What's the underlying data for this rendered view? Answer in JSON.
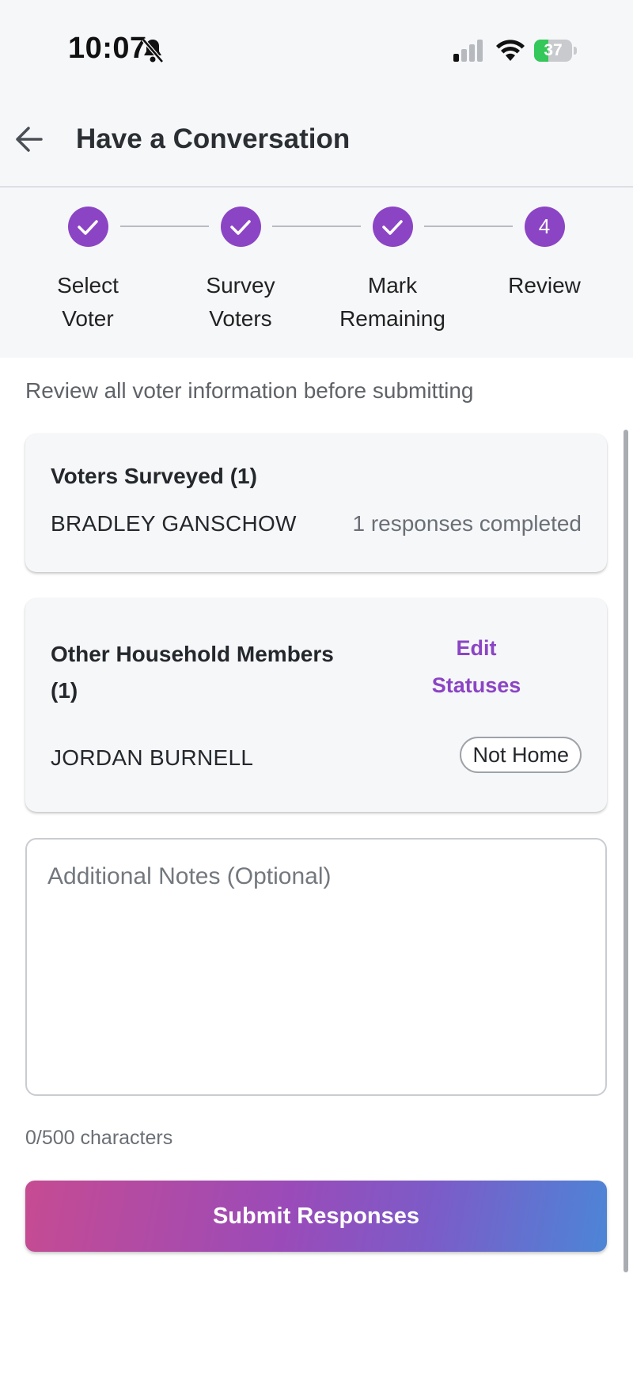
{
  "status_bar": {
    "time": "10:07",
    "battery_level": "37",
    "icons": [
      "bell-slash-icon",
      "signal-icon",
      "wifi-icon",
      "battery-charging-icon"
    ]
  },
  "header": {
    "title": "Have a Conversation",
    "back_icon": "arrow-left-icon"
  },
  "stepper": {
    "accent_color": "#8b45c4",
    "steps": [
      {
        "label": "Select Voter",
        "state": "complete",
        "number": "1"
      },
      {
        "label": "Survey Voters",
        "state": "complete",
        "number": "2"
      },
      {
        "label": "Mark Remaining",
        "state": "complete",
        "number": "3"
      },
      {
        "label": "Review",
        "state": "current",
        "number": "4"
      }
    ]
  },
  "review": {
    "instruction": "Review all voter information before submitting",
    "surveyed": {
      "title": "Voters Surveyed (1)",
      "voters": [
        {
          "name": "BRADLEY GANSCHOW",
          "status": "1 responses completed"
        }
      ]
    },
    "household": {
      "title": "Other Household Members (1)",
      "edit_label": "Edit Statuses",
      "members": [
        {
          "name": "JORDAN BURNELL",
          "status": "Not Home"
        }
      ]
    },
    "notes": {
      "placeholder": "Additional Notes (Optional)",
      "value": "",
      "char_count": "0/500 characters"
    },
    "submit_label": "Submit Responses"
  },
  "colors": {
    "accent": "#8b45c4",
    "submit_gradient": [
      "#c64b92",
      "#9a4bb9",
      "#4c85d6"
    ]
  }
}
